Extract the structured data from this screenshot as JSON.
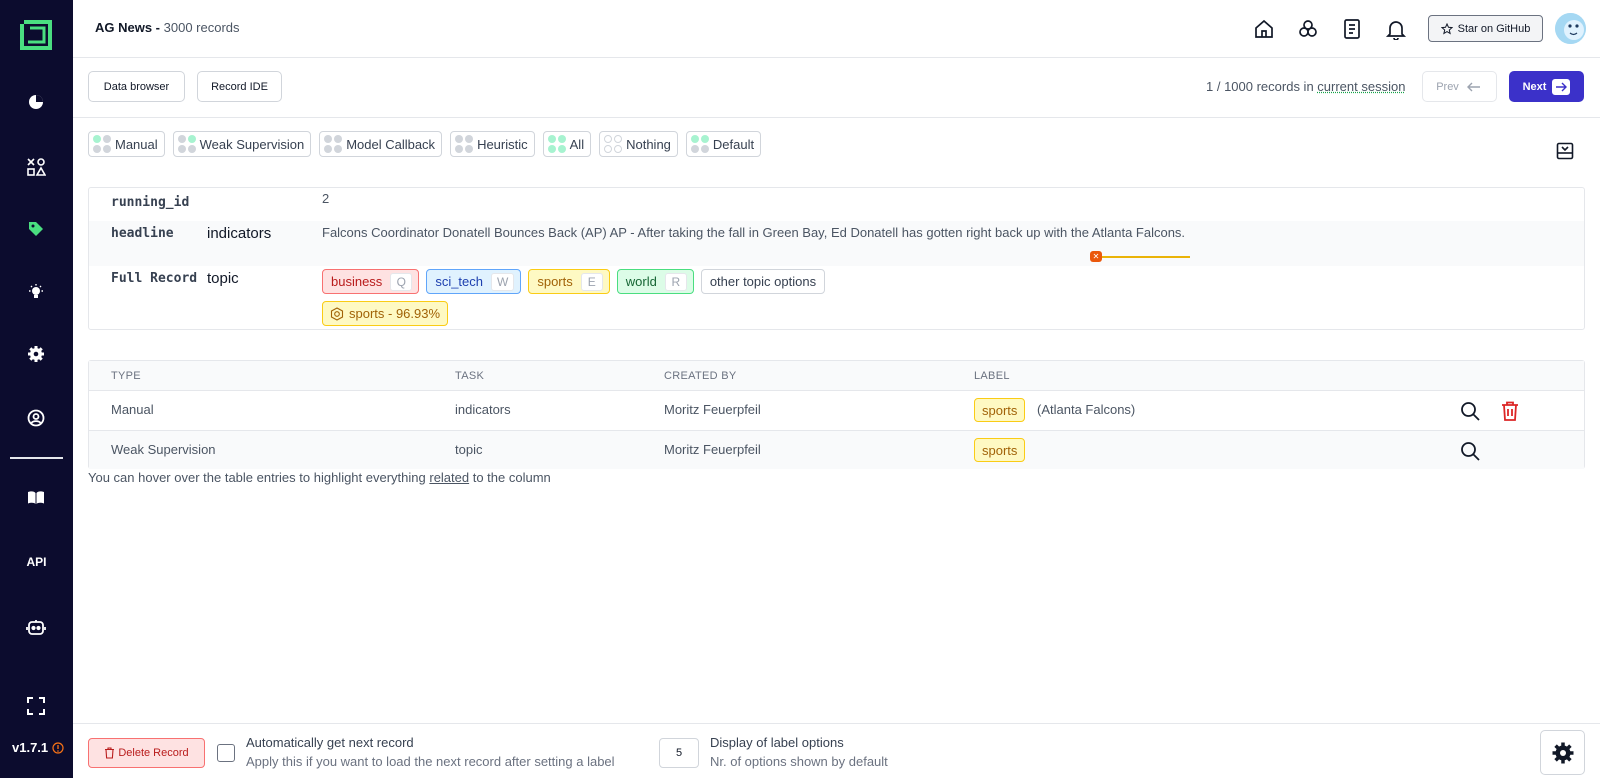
{
  "app": {
    "project_name": "AG News - ",
    "record_count": "3000 records",
    "version": "v1.7.1"
  },
  "header": {
    "github_label": "Star on GitHub",
    "icons": [
      "home-icon",
      "cluster-icon",
      "document-icon",
      "bell-icon"
    ]
  },
  "sidebar": {
    "items": [
      "overview-icon",
      "shapes-icon",
      "labeling-icon",
      "heuristics-icon",
      "settings-icon",
      "account-icon",
      "docs-icon",
      "api",
      "bot-icon",
      "fullscreen-icon"
    ],
    "api_label": "API"
  },
  "toolbar": {
    "data_browser_label": "Data browser",
    "record_ide_label": "Record IDE",
    "session_prefix": "1 / 1000 records in ",
    "session_link": "current session",
    "prev_label": "Prev",
    "next_label": "Next"
  },
  "filters": [
    {
      "label": "Manual",
      "dots": [
        "g",
        "gr",
        "gr",
        "gr"
      ]
    },
    {
      "label": "Weak Supervision",
      "dots": [
        "gr",
        "g",
        "gr",
        "gr"
      ]
    },
    {
      "label": "Model Callback",
      "dots": [
        "gr",
        "gr",
        "gr",
        "gr"
      ]
    },
    {
      "label": "Heuristic",
      "dots": [
        "gr",
        "gr",
        "gr",
        "gr"
      ]
    },
    {
      "label": "All",
      "dots": [
        "g",
        "g",
        "g",
        "g"
      ]
    },
    {
      "label": "Nothing",
      "dots": [
        "w",
        "w",
        "w",
        "w"
      ]
    },
    {
      "label": "Default",
      "dots": [
        "g",
        "g",
        "gr",
        "gr"
      ]
    }
  ],
  "record": {
    "running_id_attr": "running_id",
    "running_id_value": "2",
    "headline_attr": "headline",
    "headline_task": "indicators",
    "headline_value": "Falcons Coordinator Donatell Bounces Back (AP) AP - After taking the fall in Green Bay, Ed Donatell has gotten right back up with the Atlanta Falcons.",
    "full_record_attr": "Full Record",
    "topic_task": "topic",
    "label_options": [
      {
        "name": "business",
        "key": "Q",
        "color": "red"
      },
      {
        "name": "sci_tech",
        "key": "W",
        "color": "blue"
      },
      {
        "name": "sports",
        "key": "E",
        "color": "yellow"
      },
      {
        "name": "world",
        "key": "R",
        "color": "green"
      }
    ],
    "other_options_label": "other topic options",
    "prediction": "sports - 96.93%"
  },
  "table": {
    "headers": [
      "TYPE",
      "TASK",
      "CREATED BY",
      "LABEL"
    ],
    "rows": [
      {
        "type": "Manual",
        "task": "indicators",
        "created_by": "Moritz Feuerpfeil",
        "label": "sports",
        "extra": "(Atlanta Falcons)"
      },
      {
        "type": "Weak Supervision",
        "task": "topic",
        "created_by": "Moritz Feuerpfeil",
        "label": "sports",
        "extra": ""
      }
    ],
    "hint_before": "You can hover over the table entries to highlight everything ",
    "hint_link": "related",
    "hint_after": " to the column"
  },
  "bottom": {
    "delete_label": "Delete Record",
    "auto_next_title": "Automatically get next record",
    "auto_next_sub": "Apply this if you want to load the next record after setting a label",
    "num_options_value": "5",
    "display_title": "Display of label options",
    "display_sub": "Nr. of options shown by default"
  },
  "colors": {
    "sidebar_bg": "#0c0c2e",
    "primary": "#3b31c9",
    "active_nav": "#4ade80"
  }
}
